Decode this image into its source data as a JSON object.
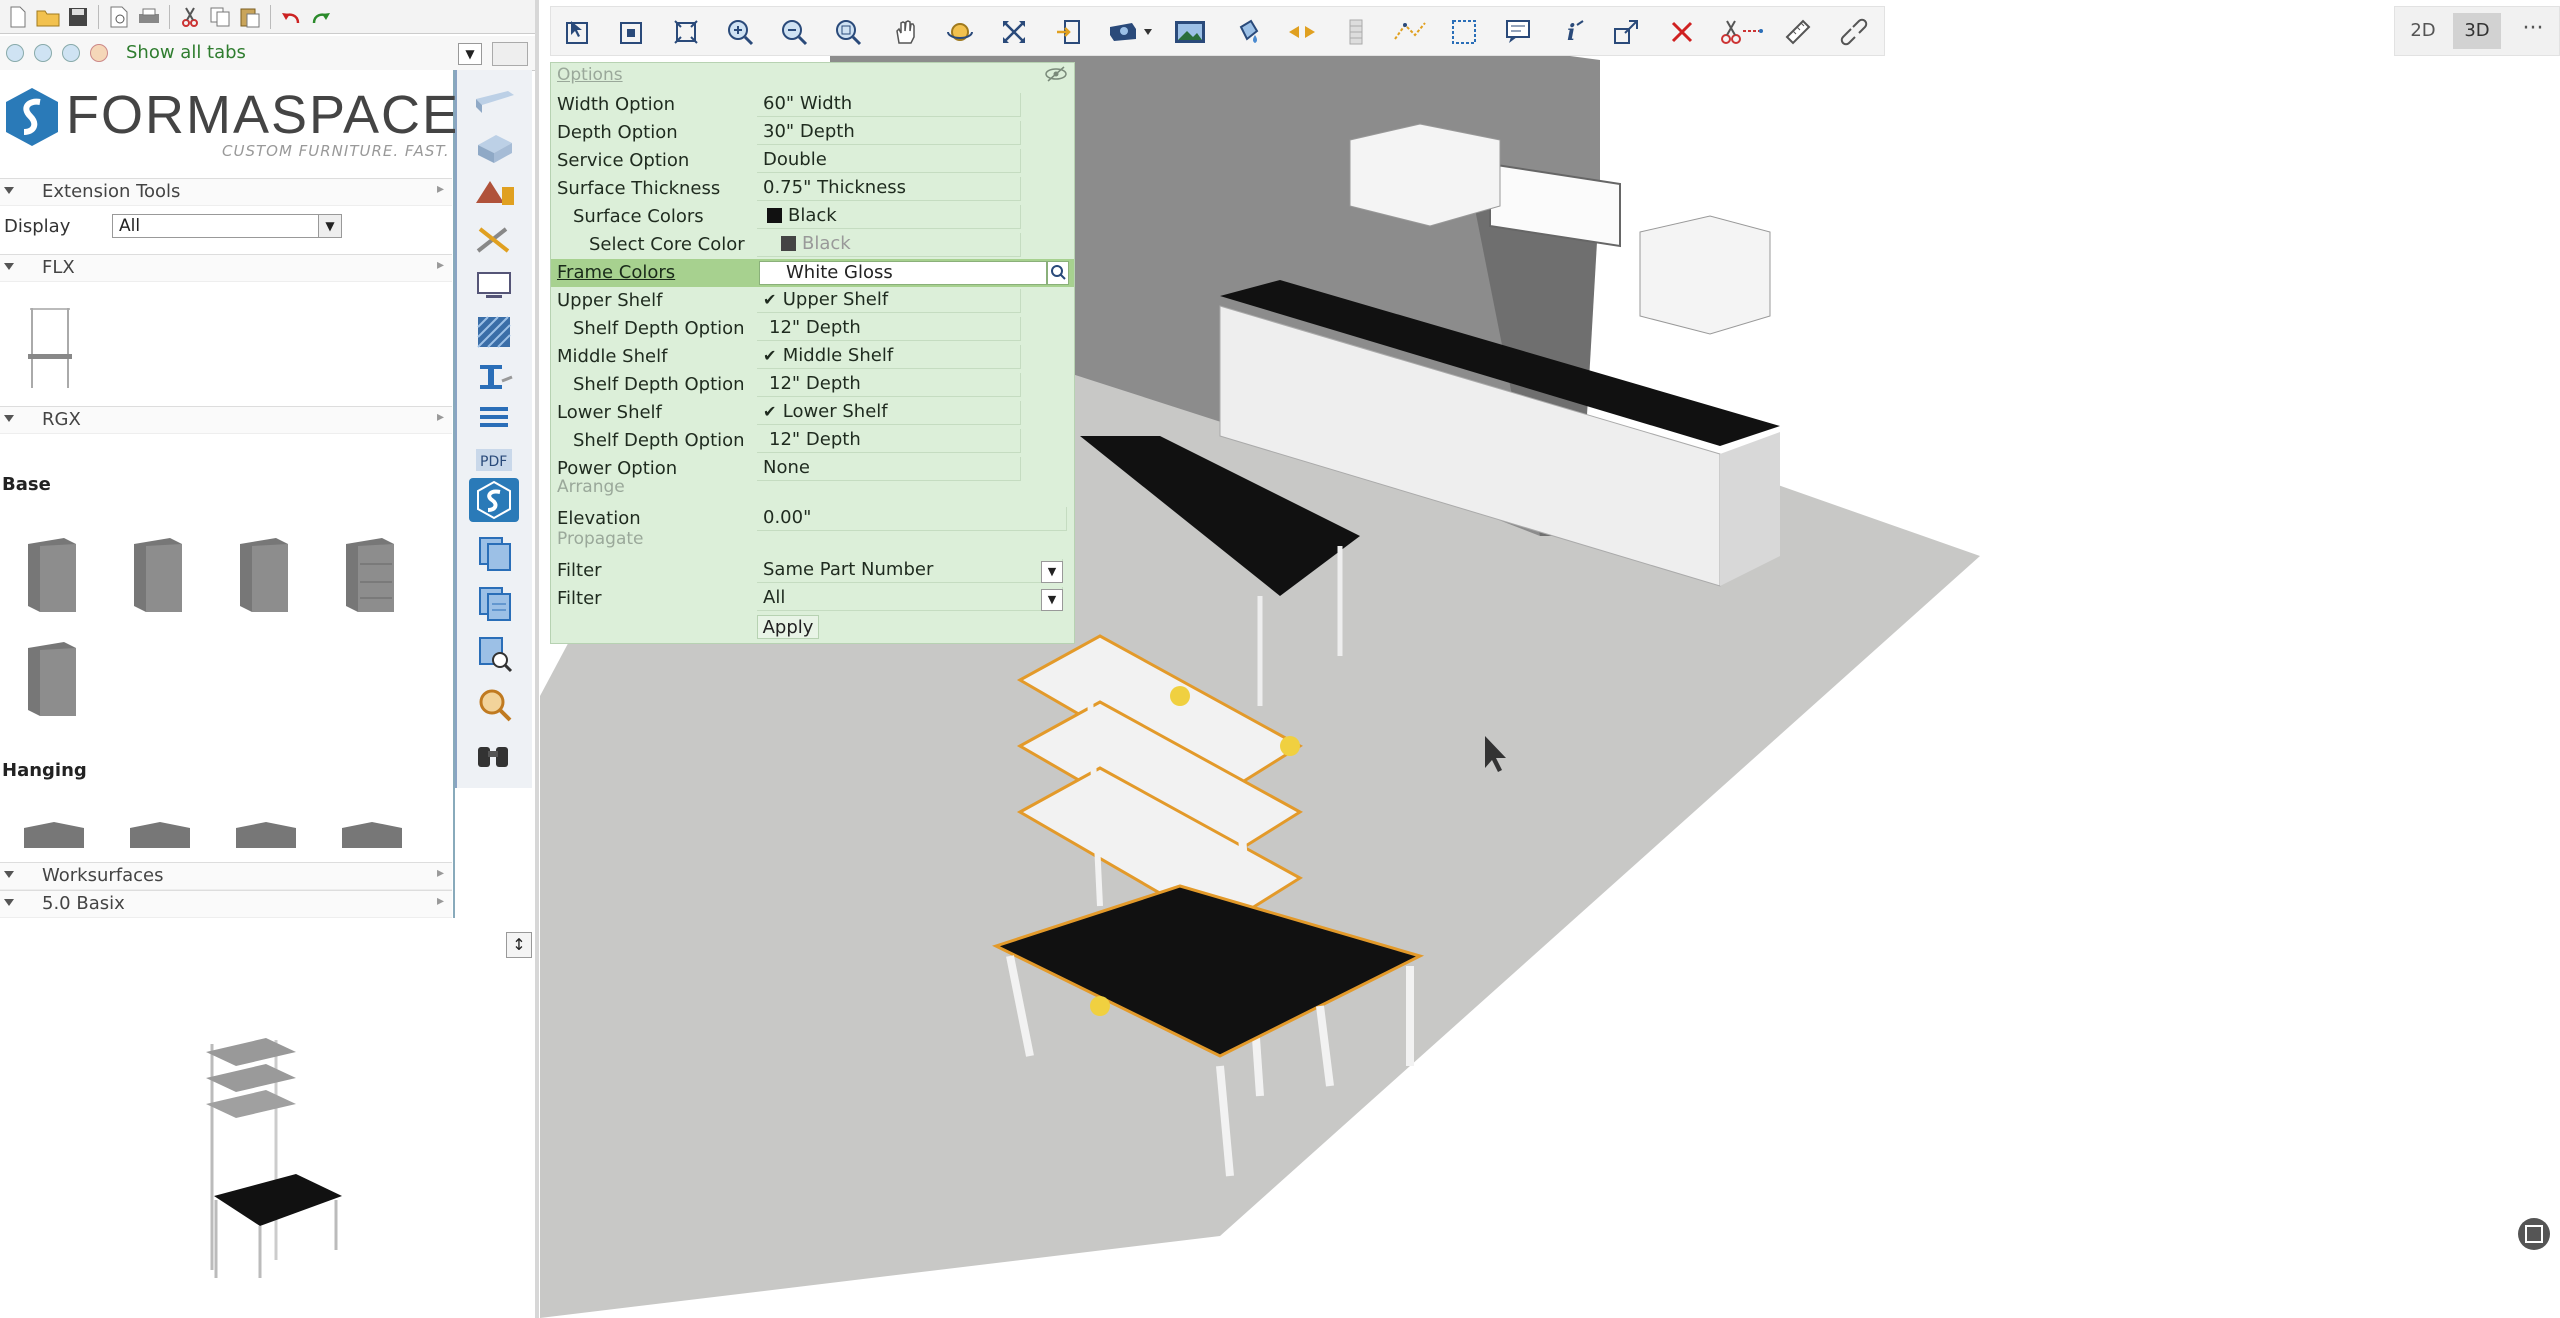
{
  "top_left": {
    "show_all_tabs": "Show all tabs"
  },
  "brand": {
    "name": "FORMASPACE",
    "tagline": "CUSTOM FURNITURE. FAST.",
    "color": "#2a7ab8"
  },
  "library": {
    "extension_tools": "Extension Tools",
    "display_label": "Display",
    "display_value": "All",
    "sections": {
      "flx": "FLX",
      "rgx": "RGX",
      "worksurfaces": "Worksurfaces",
      "basix": "5.0 Basix"
    },
    "group_base": "Base",
    "group_hanging": "Hanging"
  },
  "view_toggle": {
    "btn_2d": "2D",
    "btn_3d": "3D",
    "more": "···",
    "active": "3D"
  },
  "options_panel": {
    "title": "Options",
    "rows": [
      {
        "label": "Width Option",
        "value": "60\" Width"
      },
      {
        "label": "Depth Option",
        "value": "30\" Depth"
      },
      {
        "label": "Service Option",
        "value": "Double"
      },
      {
        "label": "Surface Thickness",
        "value": "0.75\" Thickness"
      },
      {
        "label": "Surface Colors",
        "value": "Black"
      },
      {
        "label": "Select Core Color",
        "value": "Black"
      },
      {
        "label": "Frame Colors",
        "value": "White Gloss"
      },
      {
        "label": "Upper Shelf",
        "value": "Upper Shelf"
      },
      {
        "label": "Shelf Depth Option",
        "value": "12\" Depth"
      },
      {
        "label": "Middle Shelf",
        "value": "Middle Shelf"
      },
      {
        "label": "Shelf Depth Option",
        "value": "12\" Depth"
      },
      {
        "label": "Lower Shelf",
        "value": "Lower Shelf"
      },
      {
        "label": "Shelf Depth Option",
        "value": "12\" Depth"
      },
      {
        "label": "Power Option",
        "value": "None"
      }
    ],
    "section_arrange": "Arrange",
    "elevation_label": "Elevation",
    "elevation_value": "0.00\"",
    "section_propagate": "Propagate",
    "filter1_label": "Filter",
    "filter1_value": "Same Part Number",
    "filter2_label": "Filter",
    "filter2_value": "All",
    "apply": "Apply",
    "highlight_color": "#a7d18f",
    "panel_color": "#dcefd9"
  },
  "toolbar_icons": [
    "select-icon",
    "select-all-icon",
    "zoom-extents-icon",
    "zoom-in-icon",
    "zoom-out-icon",
    "zoom-window-icon",
    "pan-icon",
    "orbit-icon",
    "fit-icon",
    "export-icon",
    "render-icon",
    "image-icon",
    "paint-icon",
    "mirror-icon",
    "wall-icon",
    "dimension-icon",
    "area-select-icon",
    "comment-icon",
    "info-icon",
    "resize-icon",
    "delete-icon",
    "cut-icon",
    "measure-icon",
    "unlink-icon"
  ]
}
